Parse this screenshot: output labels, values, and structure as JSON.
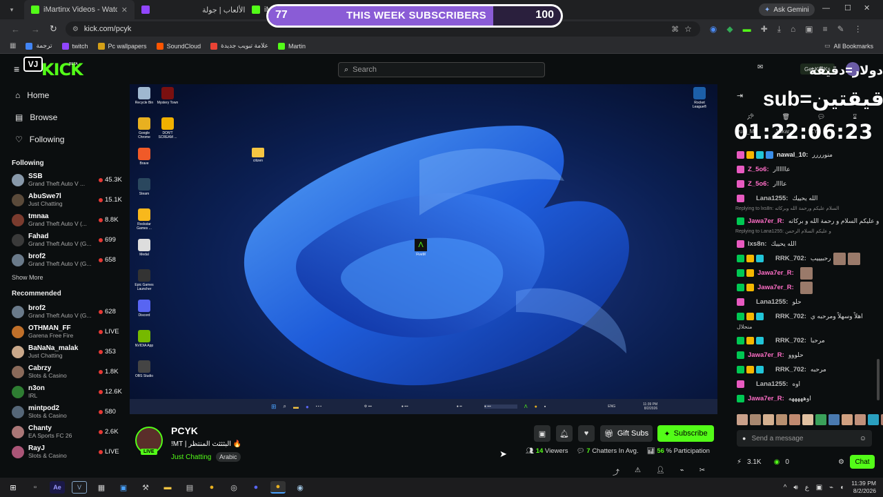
{
  "browser": {
    "tabs": [
      {
        "label": "iMartinx Videos - Watch On-De",
        "color": "#53fc18"
      },
      {
        "label": "الألعاب | جولة",
        "color": "#9146ff"
      },
      {
        "label": "iMar",
        "color": "#53fc18"
      }
    ],
    "url": "kick.com/pcyk",
    "ask_gemini": "Ask Gemini",
    "bookmarks": [
      {
        "label": "ترجمة",
        "color": "#4285f4"
      },
      {
        "label": "twitch",
        "color": "#9146ff"
      },
      {
        "label": "Pc wallpapers",
        "color": "#d4a017"
      },
      {
        "label": "SoundCloud",
        "color": "#ff5500"
      },
      {
        "label": "علامة تبويب جديدة",
        "color": "#ea4335"
      },
      {
        "label": "Martin",
        "color": "#53fc18"
      }
    ],
    "all_bookmarks": "All Bookmarks"
  },
  "overlay": {
    "sub_current": "77",
    "sub_label": "THIS WEEK SUBSCRIBERS",
    "sub_goal": "100",
    "progress": 0.77,
    "rule_line1": "دولار=دقيقة",
    "rule_line2": "sub=دقيقتين",
    "timer": "01:22:06:23",
    "logo_text": "VJ"
  },
  "kick": {
    "logo": "KICK",
    "beta": "BETA",
    "search_placeholder": "Search",
    "get_kicks": "Get KICKs",
    "nav": [
      {
        "label": "Home",
        "icon": "home-icon"
      },
      {
        "label": "Browse",
        "icon": "browse-icon"
      },
      {
        "label": "Following",
        "icon": "heart-icon"
      }
    ],
    "following_title": "Following",
    "following": [
      {
        "name": "SSB",
        "game": "Grand Theft Auto V ...",
        "viewers": "45.3K",
        "color": "#8899aa"
      },
      {
        "name": "AbuSwe7l",
        "game": "Just Chatting",
        "viewers": "15.1K",
        "color": "#5a4a3a"
      },
      {
        "name": "tmnaa",
        "game": "Grand Theft Auto V (...",
        "viewers": "8.8K",
        "color": "#7a3b2e"
      },
      {
        "name": "Fahad",
        "game": "Grand Theft Auto V (G...",
        "viewers": "699",
        "color": "#3a3a3a"
      },
      {
        "name": "brof2",
        "game": "Grand Theft Auto V (G...",
        "viewers": "658",
        "color": "#6a7a8a"
      }
    ],
    "show_more": "Show More",
    "recommended_title": "Recommended",
    "recommended": [
      {
        "name": "brof2",
        "game": "Grand Theft Auto V (G...",
        "viewers": "628",
        "color": "#6a7a8a"
      },
      {
        "name": "OTHMAN_FF",
        "game": "Garena Free Fire",
        "viewers": "LIVE",
        "color": "#c0702a"
      },
      {
        "name": "BaNaNa_malak",
        "game": "Just Chatting",
        "viewers": "353",
        "color": "#c9a88a"
      },
      {
        "name": "Cabrzy",
        "game": "Slots & Casino",
        "viewers": "1.8K",
        "color": "#8a6a5a"
      },
      {
        "name": "n3on",
        "game": "IRL",
        "viewers": "12.6K",
        "color": "#2e7d32"
      },
      {
        "name": "mintpod2",
        "game": "Slots & Casino",
        "viewers": "580",
        "color": "#556677"
      },
      {
        "name": "Chanty",
        "game": "EA Sports FC 26",
        "viewers": "2.6K",
        "color": "#a77"
      },
      {
        "name": "RayJ",
        "game": "Slots & Casino",
        "viewers": "LIVE",
        "color": "#aa5577"
      }
    ]
  },
  "desktop": {
    "left_icons": [
      {
        "label": "Recycle Bin",
        "color": "#9fb8d0"
      },
      {
        "label": "Google Chrome",
        "color": "#e8b020"
      },
      {
        "label": "Brave",
        "color": "#f05a28"
      },
      {
        "label": "Steam",
        "color": "#2a475e"
      },
      {
        "label": "Rockstar Games ...",
        "color": "#f8b81c"
      },
      {
        "label": "Medal",
        "color": "#dddddd"
      },
      {
        "label": "Epic Games Launcher",
        "color": "#333333"
      },
      {
        "label": "Discord",
        "color": "#5865f2"
      },
      {
        "label": "NVIDIA App",
        "color": "#76b900"
      },
      {
        "label": "OBS Studio",
        "color": "#444444"
      }
    ],
    "col2_icons": [
      {
        "label": "Mystery Town",
        "color": "#7a1010"
      },
      {
        "label": "DON'T SCREAM ...",
        "color": "#f0b000"
      }
    ],
    "folder_label": "citizen",
    "fivem_label": "FiveM",
    "rocket_label": "Rocket League®",
    "tray_lang": "ENG",
    "time": "11:39 PM",
    "date": "8/2/2026"
  },
  "stream": {
    "channel": "PCYK",
    "title": "!MT | البثثثث المنتظر 🔥",
    "category": "Just Chatting",
    "language_tag": "Arabic",
    "live_badge": "LIVE",
    "gift_subs": "Gift Subs",
    "subscribe": "Subscribe",
    "viewers_num": "14",
    "viewers_label": "Viewers",
    "chatters_num": "7",
    "chatters_label": "Chatters In Avg.",
    "participation_num": "56",
    "participation_label": "% Participation"
  },
  "chat": {
    "top_row": [
      {
        "user": "yuki_M"
      },
      {
        "user": "Jalkar"
      },
      {
        "user": "ZYA"
      }
    ],
    "messages": [
      {
        "badges": [
          "sub",
          "crown",
          "gift",
          "shield"
        ],
        "user": "nawal_10",
        "color": "#e8e8e8",
        "text": "منورررر",
        "type": "msg"
      },
      {
        "badges": [
          "sub"
        ],
        "user": "Z_5o6",
        "color": "#ff6ec7",
        "text": "عاااااار",
        "type": "msg"
      },
      {
        "badges": [
          "sub"
        ],
        "user": "Z_5o6",
        "color": "#ff6ec7",
        "text": "عاااار",
        "type": "msg"
      },
      {
        "badges": [
          "sub"
        ],
        "user": "Lana1255",
        "color": "#bbbbbb",
        "text": "الله يحييك",
        "type": "msg",
        "indent": true
      },
      {
        "reply": "Replying to lxs8n: السلام عليكم ورحمة الله وبركاته",
        "type": "reply"
      },
      {
        "badges": [
          "mod"
        ],
        "user": "Jawa7er_R",
        "color": "#ff6ec7",
        "text": "و عليكم السلام و رحمة الله و بركاته",
        "type": "msg"
      },
      {
        "reply": "Replying to Lana1255: و عليكم السلام الرحمن",
        "type": "reply"
      },
      {
        "badges": [
          "sub"
        ],
        "user": "lxs8n",
        "color": "#bbbbbb",
        "text": "الله يحييك",
        "type": "msg"
      },
      {
        "badges": [
          "mod",
          "crown",
          "gift"
        ],
        "user": "RRK_702",
        "color": "#bbbbbb",
        "text": "رحبيييب",
        "type": "msg",
        "indent": true,
        "emotes": 2
      },
      {
        "badges": [
          "mod",
          "crown"
        ],
        "user": "Jawa7er_R",
        "color": "#ff6ec7",
        "text": "",
        "type": "msg",
        "emotes": 1
      },
      {
        "badges": [
          "mod",
          "crown"
        ],
        "user": "Jawa7er_R",
        "color": "#ff6ec7",
        "text": "",
        "type": "msg",
        "emotes": 1
      },
      {
        "badges": [
          "sub"
        ],
        "user": "Lana1255",
        "color": "#bbbbbb",
        "text": "حلو",
        "type": "msg",
        "indent": true
      },
      {
        "badges": [
          "mod",
          "crown",
          "gift"
        ],
        "user": "RRK_702",
        "color": "#bbbbbb",
        "text": "اهلاً وسهلاً ومرحبه ي",
        "type": "msg",
        "indent": true
      },
      {
        "reply": "منحلال",
        "type": "cont"
      },
      {
        "badges": [
          "mod",
          "crown",
          "gift"
        ],
        "user": "RRK_702",
        "color": "#bbbbbb",
        "text": "مرحبا",
        "type": "msg",
        "indent": true
      },
      {
        "badges": [
          "mod"
        ],
        "user": "Jawa7er_R",
        "color": "#ff6ec7",
        "text": "حلووو",
        "type": "msg"
      },
      {
        "badges": [
          "mod",
          "crown",
          "gift"
        ],
        "user": "RRK_702",
        "color": "#bbbbbb",
        "text": "مرحبه",
        "type": "msg",
        "indent": true
      },
      {
        "badges": [
          "sub"
        ],
        "user": "Lana1255",
        "color": "#bbbbbb",
        "text": "اوه",
        "type": "msg",
        "indent": true
      },
      {
        "badges": [
          "mod"
        ],
        "user": "Jawa7er_R",
        "color": "#ff6ec7",
        "text": "اوهههههه",
        "type": "msg"
      }
    ],
    "input_placeholder": "Send a message",
    "kicks_count": "3.1K",
    "points_count": "0",
    "chat_button": "Chat"
  },
  "taskbar": {
    "time": "11:39 PM",
    "date": "8/2/2026",
    "lang": "ع"
  },
  "colors": {
    "kick_green": "#53fc18",
    "overlay_purple": "#8a5cd6",
    "mod_green": "#00c853",
    "sub_pink": "#e85ac0"
  }
}
